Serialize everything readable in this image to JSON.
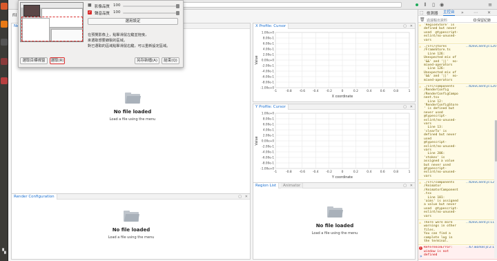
{
  "dialog": {
    "image_quality_label": "影像品質",
    "image_quality_value": "100",
    "audio_quality_label": "聲音品質",
    "audio_quality_value": "100",
    "apply_button": "選用設定",
    "instructions": [
      "在預覽影像上，點擊滑鼠左鍵並拖曳，",
      "來選取想要錄製的區域。",
      "對已選取的區域點擊滑鼠右鍵，可以重新設定區域。"
    ],
    "select_target_button": "選取目標視窗",
    "select_button": "選取(R)",
    "save_button": "另存新檔(A)",
    "exit_button": "結束(Q)"
  },
  "browser": {
    "left_tab_fragment": "Fil",
    "top_panel_tab_fragment": "Ne"
  },
  "panels": {
    "main_viewer": {
      "title": "No file loaded",
      "hint": "Load a file using the menu"
    },
    "render_config": {
      "tab": "Render Configuration",
      "title": "No file loaded",
      "hint": "Load a file using the menu"
    },
    "region_list": {
      "tab": "Region List",
      "tab2": "Animator",
      "title": "No file loaded",
      "hint": "Load a file using the menu"
    }
  },
  "chart_data": [
    {
      "type": "line",
      "title": "X Profile: Cursor",
      "xlabel": "X coordinate",
      "ylabel": "Value",
      "xlim": [
        -1,
        1
      ],
      "ylim": [
        -1e-06,
        1e-06
      ],
      "x_ticks": [
        "-1",
        "-0.8",
        "-0.6",
        "-0.4",
        "-0.2",
        "0",
        "0.2",
        "0.4",
        "0.6",
        "0.8",
        "1"
      ],
      "y_ticks": [
        "1.00e+0",
        "8.00e-1",
        "6.00e-1",
        "4.00e-1",
        "2.00e-1",
        "0.00e+0",
        "-2.00e-1",
        "-4.00e-1",
        "-6.00e-1",
        "-8.00e-1",
        "-1.00e+0"
      ],
      "grid": true,
      "series": []
    },
    {
      "type": "line",
      "title": "Y Profile: Cursor",
      "xlabel": "Y coordinate",
      "ylabel": "Value",
      "xlim": [
        -1,
        1
      ],
      "ylim": [
        -1e-06,
        1e-06
      ],
      "x_ticks": [
        "-1",
        "-0.8",
        "-0.6",
        "-0.4",
        "-0.2",
        "0",
        "0.2",
        "0.4",
        "0.6",
        "0.8",
        "1"
      ],
      "y_ticks": [
        "1.00e+0",
        "8.00e-1",
        "6.00e-1",
        "4.00e-1",
        "2.00e-1",
        "0.00e+0",
        "-2.00e-1",
        "-4.00e-1",
        "-6.00e-1",
        "-8.00e-1",
        "-1.00e+0"
      ],
      "grid": true,
      "series": []
    }
  ],
  "devtools": {
    "tab_inspector": "檢測器",
    "tab_console": "主控台",
    "filter_placeholder": "過濾輸出資料",
    "persist_label": "保留紀錄",
    "messages": [
      {
        "kind": "warn",
        "src": "",
        "text": "'RegionStore' is\ndefined but never\nused  @typescript-\neslint/no-unused-\nvars"
      },
      {
        "kind": "warn",
        "src": "…tDevClient.js:120",
        "text": "./src/stores\n/FrameStore.ts\n  Line 126:\nUnexpected mix of\n'&&' and '||'  no-\nmixed-operators\n  Line 126:\nUnexpected mix of\n'&&' and '||'  no-\nmixed-operators"
      },
      {
        "kind": "warn",
        "src": "…tDevClient.js:120",
        "text": "./src/components\n/RenderConfig\n/RenderConfigCompo\nnent.tsx\n  Line 12:\n'RenderConfigStore\n' is defined but\nnever used\n@typescript-\neslint/no-unused-\nvars\n  Line 13:\n'clearTo' is\ndefined but never\nused\n@typescript-\neslint/no-unused-\nvars\n  Line 206:\n'stokes' is\nassigned a value\nbut never used\n@typescript-\neslint/no-unused-\nvars"
      },
      {
        "kind": "warn",
        "src": "…tDevClient.js:120",
        "text": "./src/components\n/Animator\n/AnimatorComponent\n.tsx\n  Line 101:\n'aims' is assigned\na value but never\nused  @typescript-\neslint/no-unused-\nvars"
      },
      {
        "kind": "warn",
        "src": "…tDevClient.js:116",
        "text": "There were more\nwarnings in other\nfiles.\nYou can find a\ncomplete log in\nthe terminal."
      },
      {
        "kind": "err",
        "src": "…67.worker.js:2:15",
        "text": "ReferenceError:\nwindow is not\ndefined"
      }
    ]
  },
  "colors": {
    "accent": "#1a6fd0",
    "record_red": "#d92b2b",
    "warning_bg": "#fffbe5"
  }
}
